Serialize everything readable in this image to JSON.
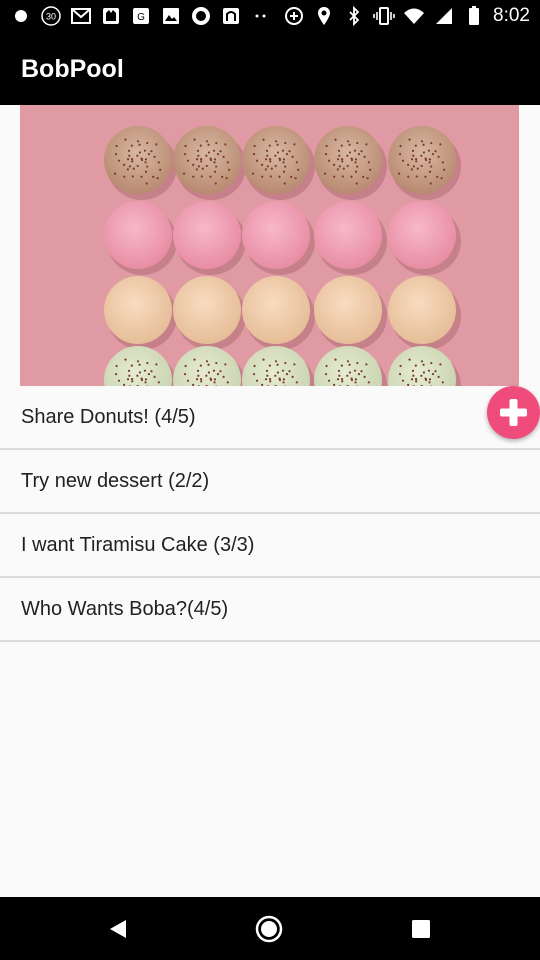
{
  "status_bar": {
    "time": "8:02",
    "left_icons": [
      "record-icon",
      "speed-badge-icon",
      "gmail-icon",
      "cat-app-icon",
      "maps-icon",
      "image-icon",
      "media-icon",
      "mail-icon",
      "more-icon"
    ],
    "right_icons": [
      "data-saver-icon",
      "location-icon",
      "bluetooth-icon",
      "vibrate-icon",
      "wifi-icon",
      "signal-icon",
      "battery-icon"
    ],
    "speed_badge": "30"
  },
  "app_bar": {
    "title": "BobPool"
  },
  "hero": {
    "image": "macarons-photo"
  },
  "pools": [
    {
      "label": "Share Donuts!  (4/5)"
    },
    {
      "label": "Try new dessert (2/2)"
    },
    {
      "label": "I want Tiramisu Cake (3/3)"
    },
    {
      "label": "Who Wants Boba?(4/5)"
    }
  ],
  "fab": {
    "icon": "add-icon",
    "color": "#ef4c7c"
  },
  "nav_bar": {
    "buttons": [
      "back-icon",
      "home-icon",
      "recents-icon"
    ]
  },
  "colors": {
    "app_bar": "#000000",
    "background": "#fafafa",
    "accent": "#ef4c7c"
  }
}
